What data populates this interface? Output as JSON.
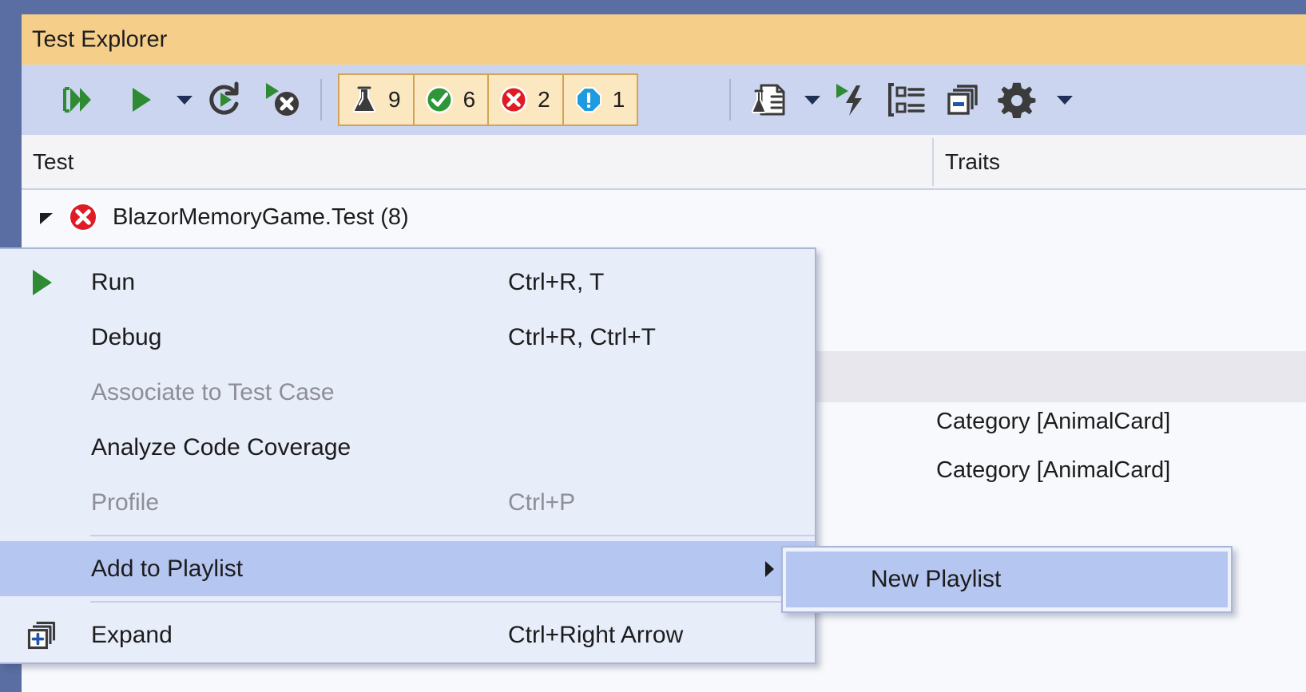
{
  "window": {
    "tool_title": "Test Explorer"
  },
  "toolbar": {
    "buttons": [
      {
        "name": "run-all-tests",
        "icon": "run-all-icon"
      },
      {
        "name": "run-selected-tests",
        "icon": "play-icon"
      },
      {
        "name": "run-dropdown",
        "icon": "chevron-down-icon"
      },
      {
        "name": "repeat-last-run",
        "icon": "repeat-run-icon"
      },
      {
        "name": "cancel-test-run",
        "icon": "stop-run-icon"
      }
    ],
    "right_buttons": [
      {
        "name": "test-detail-summary",
        "icon": "test-document-icon"
      },
      {
        "name": "test-detail-dropdown",
        "icon": "chevron-down-icon"
      },
      {
        "name": "run-failed-tests",
        "icon": "run-lightning-icon"
      },
      {
        "name": "group-by",
        "icon": "group-by-icon"
      },
      {
        "name": "expand-collapse",
        "icon": "stacked-windows-icon"
      },
      {
        "name": "settings",
        "icon": "gear-icon"
      },
      {
        "name": "settings-dropdown",
        "icon": "chevron-down-icon"
      }
    ],
    "status_counts": [
      {
        "key": "total",
        "icon": "flask-icon",
        "count": "9",
        "color": "#3b3b3b"
      },
      {
        "key": "passed",
        "icon": "check-circle-icon",
        "count": "6",
        "color": "#2e9639"
      },
      {
        "key": "failed",
        "icon": "error-circle-icon",
        "count": "2",
        "color": "#e01b24"
      },
      {
        "key": "not-run",
        "icon": "warning-octagon-icon",
        "count": "1",
        "color": "#1e9ae0"
      }
    ]
  },
  "grid": {
    "columns": [
      {
        "key": "test",
        "label": "Test"
      },
      {
        "key": "traits",
        "label": "Traits"
      }
    ],
    "rows": [
      {
        "name": "BlazorMemoryGame.Test (8)",
        "status_icon": "error-circle-icon",
        "expanded": true,
        "traits": ""
      },
      {
        "name": "",
        "status_icon": "",
        "traits": ""
      },
      {
        "name": "",
        "status_icon": "",
        "traits": ""
      },
      {
        "name": "",
        "status_icon": "",
        "traits": "Category [AnimalCard]"
      },
      {
        "name": "",
        "status_icon": "",
        "traits": "Category [AnimalCard]"
      }
    ]
  },
  "context_menu": {
    "items": [
      {
        "label": "Run",
        "shortcut": "Ctrl+R, T",
        "icon": "play-icon",
        "disabled": false,
        "selected": false,
        "submenu": false
      },
      {
        "label": "Debug",
        "shortcut": "Ctrl+R, Ctrl+T",
        "icon": "",
        "disabled": false,
        "selected": false,
        "submenu": false
      },
      {
        "label": "Associate to Test Case",
        "shortcut": "",
        "icon": "",
        "disabled": true,
        "selected": false,
        "submenu": false
      },
      {
        "label": "Analyze Code Coverage",
        "shortcut": "",
        "icon": "",
        "disabled": false,
        "selected": false,
        "submenu": false
      },
      {
        "label": "Profile",
        "shortcut": "Ctrl+P",
        "icon": "",
        "disabled": true,
        "selected": false,
        "submenu": false
      },
      {
        "label": "Add to Playlist",
        "shortcut": "",
        "icon": "",
        "disabled": false,
        "selected": true,
        "submenu": true
      },
      {
        "label": "Expand",
        "shortcut": "Ctrl+Right Arrow",
        "icon": "stacked-windows-plus-icon",
        "disabled": false,
        "selected": false,
        "submenu": false
      }
    ]
  },
  "submenu": {
    "items": [
      {
        "label": "New Playlist",
        "selected": true
      }
    ]
  },
  "colors": {
    "frame": "#5a6ea3",
    "title_bar": "#f5ce8a",
    "toolbar": "#ccd5ef",
    "menu_bg": "#e8edfa",
    "menu_highlight": "#b5c6f0",
    "pill_bg": "#fbe7c0",
    "pill_border": "#d2a355",
    "passed": "#2e9639",
    "failed": "#e01b24",
    "notrun": "#1e9ae0"
  }
}
